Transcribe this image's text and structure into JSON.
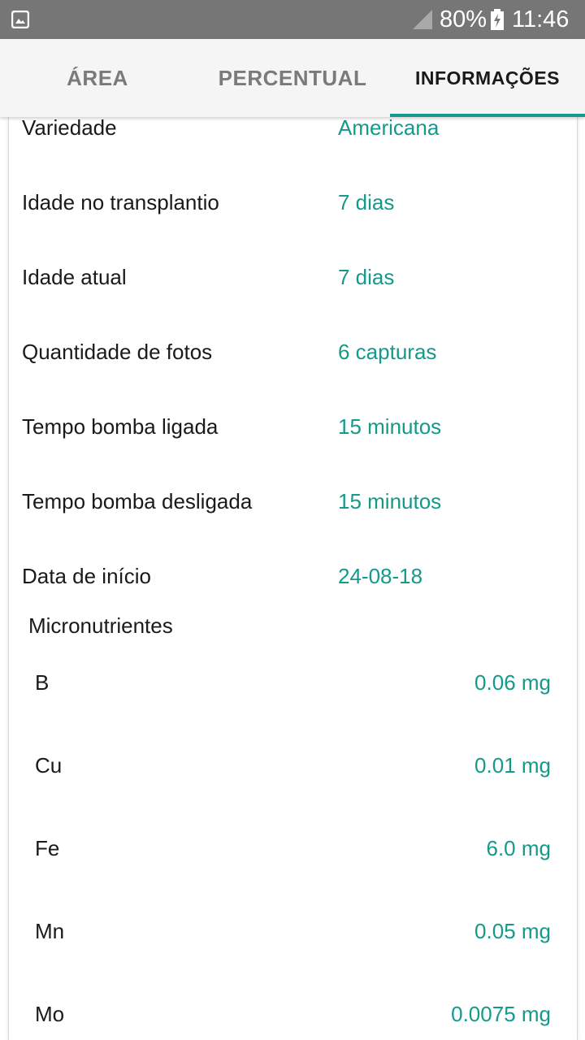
{
  "status_bar": {
    "battery_percent": "80%",
    "time": "11:46",
    "icons": [
      "image-notification-icon",
      "signal-icon",
      "battery-charging-icon"
    ]
  },
  "tabs": [
    {
      "label": "ÁREA",
      "selected": false
    },
    {
      "label": "PERCENTUAL",
      "selected": false
    },
    {
      "label": "INFORMAÇÕES",
      "selected": true
    }
  ],
  "info": [
    {
      "label": "Variedade",
      "value": "Americana"
    },
    {
      "label": "Idade no transplantio",
      "value": "7 dias"
    },
    {
      "label": "Idade atual",
      "value": "7 dias"
    },
    {
      "label": "Quantidade de fotos",
      "value": "6 capturas"
    },
    {
      "label": "Tempo bomba ligada",
      "value": "15 minutos"
    },
    {
      "label": "Tempo bomba desligada",
      "value": "15 minutos"
    },
    {
      "label": "Data de início",
      "value": "24-08-18"
    }
  ],
  "micronutrients": {
    "title": "Micronutrientes",
    "items": [
      {
        "name": "B",
        "value": "0.06 mg"
      },
      {
        "name": "Cu",
        "value": "0.01 mg"
      },
      {
        "name": "Fe",
        "value": "6.0 mg"
      },
      {
        "name": "Mn",
        "value": "0.05 mg"
      },
      {
        "name": "Mo",
        "value": "0.0075 mg"
      }
    ]
  },
  "colors": {
    "accent": "#139a8a",
    "status_bar": "#767676",
    "tab_bar": "#f5f5f5"
  }
}
